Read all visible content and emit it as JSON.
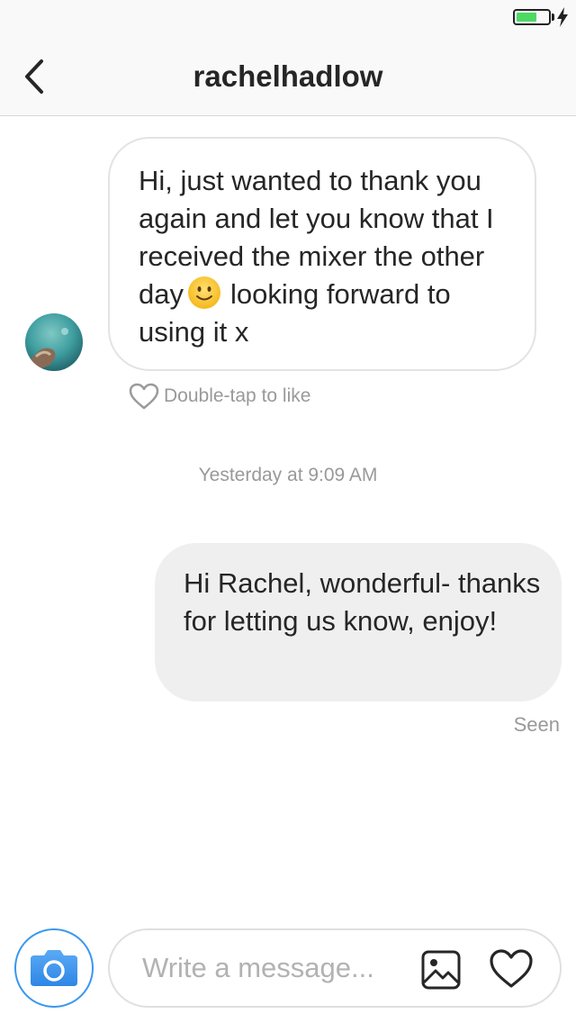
{
  "status_bar": {
    "battery_level": 0.65,
    "battery_color": "#4cd964",
    "charging": true,
    "icons": [
      "battery-icon",
      "charging-bolt-icon"
    ]
  },
  "header": {
    "title": "rachelhadlow",
    "back_icon": "chevron-left-icon"
  },
  "conversation": {
    "incoming": {
      "text_before_emoji": "Hi, just wanted to thank you again and let you know that I received the mixer the other day",
      "emoji": "slightly-smiling-face",
      "text_after_emoji": "looking forward to using it x",
      "like_hint": "Double-tap to like"
    },
    "timestamp": "Yesterday at 9:09 AM",
    "outgoing": {
      "text": "Hi Rachel, wonderful- thanks for letting us know, enjoy!",
      "status": "Seen"
    }
  },
  "composer": {
    "placeholder": "Write a message...",
    "camera_icon": "camera-icon",
    "gallery_icon": "gallery-icon",
    "heart_icon": "heart-icon",
    "accent_color": "#3897f0"
  }
}
